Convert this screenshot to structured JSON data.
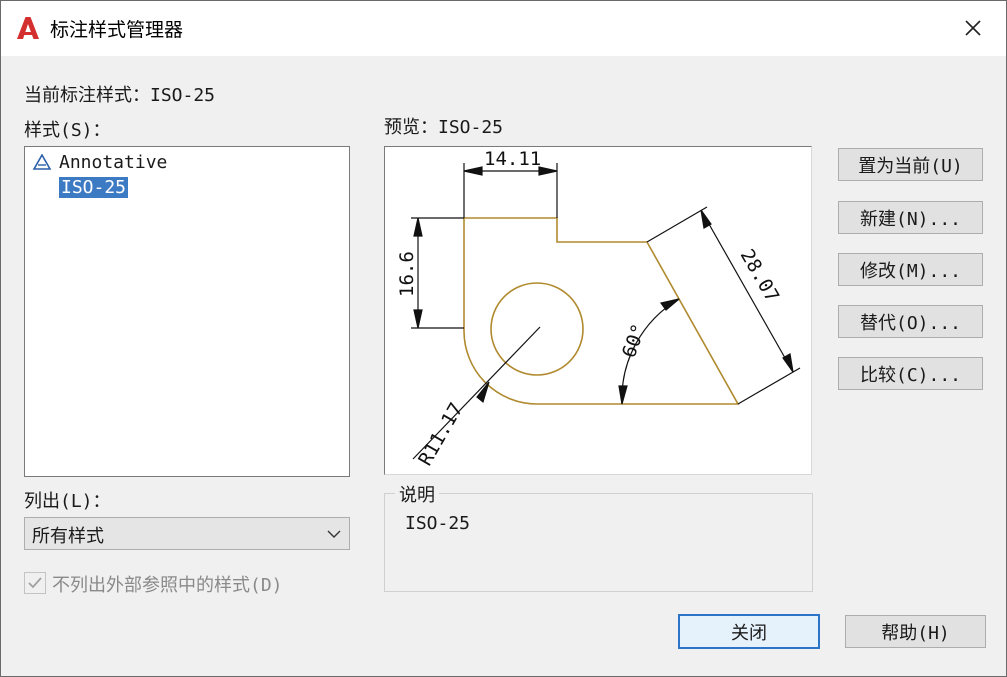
{
  "window": {
    "title": "标注样式管理器"
  },
  "current_style": {
    "label": "当前标注样式：",
    "value": "ISO-25"
  },
  "styles": {
    "label": "样式(S)：",
    "items": [
      {
        "label": "Annotative",
        "icon": "annotative-icon"
      },
      {
        "label": "ISO-25",
        "selected": true
      }
    ]
  },
  "preview": {
    "label": "预览：",
    "name": "ISO-25",
    "dimensions": [
      "14.11",
      "16.6",
      "28.07",
      "60°",
      "R11.17"
    ],
    "line_color": "#b08a2e"
  },
  "list": {
    "label": "列出(L)：",
    "selected": "所有样式"
  },
  "xref_checkbox": {
    "label": "不列出外部参照中的样式(D)",
    "checked": true
  },
  "buttons": {
    "set_current": "置为当前(U)",
    "new": "新建(N)...",
    "modify": "修改(M)...",
    "override": "替代(O)...",
    "compare": "比较(C)...",
    "close": "关闭",
    "help": "帮助(H)"
  },
  "description": {
    "label": "说明",
    "text": "ISO-25"
  },
  "colors": {
    "selection": "#3d7ac4",
    "logo_red": "#d32f2f",
    "default_button_border": "#2b74c7"
  }
}
